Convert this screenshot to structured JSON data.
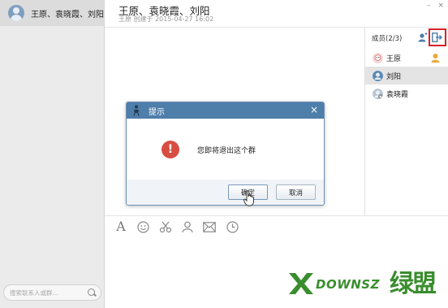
{
  "sidebar": {
    "conversation_name": "王原、袁晓霞、刘阳",
    "search_placeholder": "搜索联系人或群..."
  },
  "header": {
    "title": "王原、袁晓霞、刘阳",
    "subtitle": "王原 创建于 2015-04-27 16:02",
    "minimize": "–",
    "close": "×"
  },
  "members": {
    "header": "成员(2/3)",
    "items": [
      {
        "name": "王原"
      },
      {
        "name": "刘阳"
      },
      {
        "name": "袁晓霞"
      }
    ]
  },
  "dialog": {
    "title": "提示",
    "close": "×",
    "message": "您即将退出这个群",
    "ok_label": "确定",
    "cancel_label": "取消"
  },
  "toolbar": {
    "font_glyph": "A"
  },
  "watermark": {
    "text": "DOWNSZ",
    "cn": "绿盟"
  },
  "colors": {
    "dialog_title_bg": "#4e7eaa",
    "alert_red": "#d84d42",
    "highlight_red": "#d8222a",
    "watermark_green": "#3a8d2e"
  }
}
